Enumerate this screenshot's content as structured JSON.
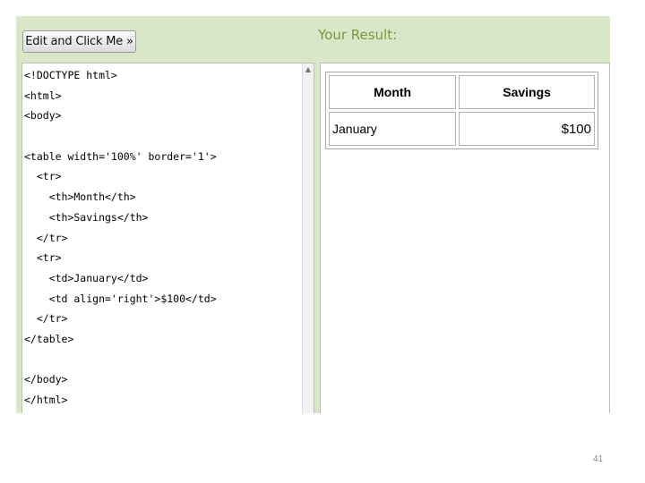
{
  "toolbar": {
    "edit_button_label": "Edit and Click Me »"
  },
  "result_panel": {
    "title": "Your Result:"
  },
  "code_editor": {
    "lines": [
      "<!DOCTYPE html>",
      "<html>",
      "<body>",
      "",
      "<table width='100%' border='1'>",
      "  <tr>",
      "    <th>Month</th>",
      "    <th>Savings</th>",
      "  </tr>",
      "  <tr>",
      "    <td>January</td>",
      "    <td align='right'>$100</td>",
      "  </tr>",
      "</table>",
      "",
      "</body>",
      "</html>"
    ]
  },
  "result_table": {
    "headers": [
      "Month",
      "Savings"
    ],
    "rows": [
      [
        "January",
        "$100"
      ]
    ]
  },
  "page_number": "41",
  "colors": {
    "frame_background": "#d9e7c8",
    "result_title": "#7f9440"
  }
}
